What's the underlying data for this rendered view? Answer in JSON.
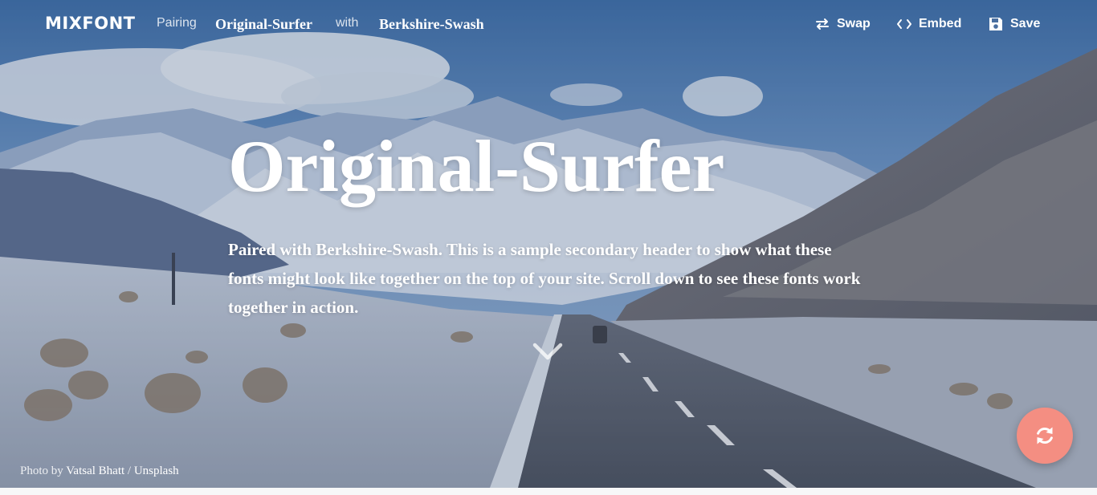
{
  "nav": {
    "logo": "MIXFONT",
    "pairing_label": "Pairing",
    "primary_font": "Original-Surfer",
    "with_label": "with",
    "secondary_font": "Berkshire-Swash",
    "swap_label": "Swap",
    "swap_icon": "swap-arrows-icon",
    "embed_label": "Embed",
    "embed_icon": "code-brackets-icon",
    "save_label": "Save",
    "save_icon": "floppy-disk-icon"
  },
  "hero": {
    "headline": "Original-Surfer",
    "subheadline": "Paired with Berkshire-Swash. This is a sample secondary header to show what these fonts might look like together on the top of your site. Scroll down to see these fonts work together in action.",
    "scroll_icon": "chevron-down-icon"
  },
  "credit": {
    "prefix": "Photo by",
    "author": "Vatsal Bhatt",
    "separator": "/",
    "source": "Unsplash"
  },
  "fab": {
    "icon": "refresh-icon",
    "color": "#f48e82"
  },
  "colors": {
    "text": "#ffffff",
    "accent": "#f48e82"
  }
}
